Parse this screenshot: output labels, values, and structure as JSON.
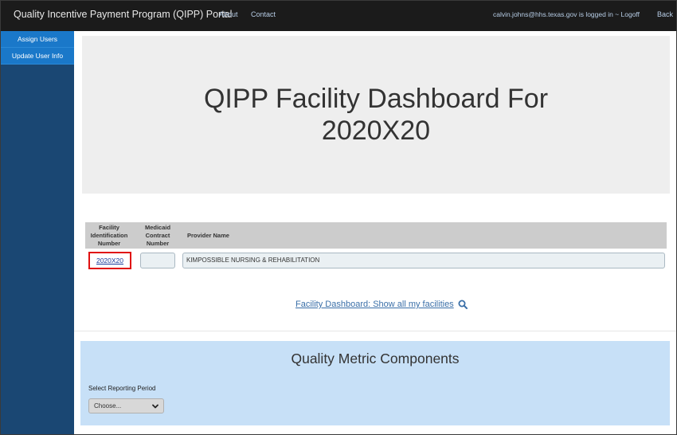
{
  "header": {
    "brand": "Quality Incentive Payment Program (QIPP) Portal",
    "about": "About",
    "contact": "Contact",
    "login_status": "calvin.johns@hhs.texas.gov is logged in ~ Logoff",
    "back": "Back"
  },
  "sidebar": {
    "items": [
      {
        "label": "Assign Users"
      },
      {
        "label": "Update User Info"
      }
    ]
  },
  "jumbotron": {
    "title": "QIPP Facility Dashboard For 2020X20"
  },
  "table": {
    "headers": {
      "facility_id": "Facility Identification Number",
      "medicaid_contract": "Medicaid Contract Number",
      "provider_name": "Provider Name"
    },
    "rows": [
      {
        "facility_id": "2020X20",
        "medicaid_contract": "",
        "provider_name": "KIMPOSSIBLE NURSING & REHABILITATION"
      }
    ]
  },
  "show_all_link": "Facility Dashboard: Show all my facilities",
  "quality_metrics": {
    "title": "Quality Metric Components",
    "select_label": "Select Reporting Period",
    "select_value": "Choose..."
  },
  "colors": {
    "nav_bg": "#1b1b1b",
    "sidebar_bg": "#1a4773",
    "sidebar_item_bg": "#1a78c9",
    "highlight_border": "#e01010",
    "panel_bg": "#c7e0f7"
  }
}
